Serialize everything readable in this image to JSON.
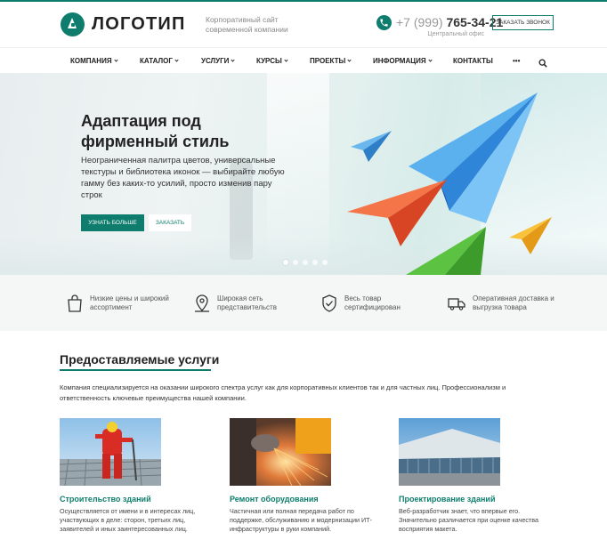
{
  "brand": {
    "logo_text": "ЛОГОТИП",
    "slogan": "Корпоративный сайт современной компании",
    "accent_color": "#0e7d6d"
  },
  "contact": {
    "phone_code": "+7 (999)",
    "phone_number": "765-34-21",
    "phone_caption": "Центральный офис",
    "order_call_label": "ЗАКАЗАТЬ ЗВОНОК"
  },
  "nav": {
    "items": [
      "КОМПАНИЯ",
      "КАТАЛОГ",
      "УСЛУГИ",
      "КУРСЫ",
      "ПРОЕКТЫ",
      "ИНФОРМАЦИЯ",
      "КОНТАКТЫ"
    ],
    "more": "•••",
    "search_icon": "search-icon"
  },
  "hero": {
    "title": "Адаптация под фирменный стиль",
    "text": "Неограниченная палитра цветов, универсальные текстуры и библиотека иконок — выбирайте любую гамму без каких-то усилий, просто изменив пару строк",
    "primary_button": "УЗНАТЬ БОЛЬШЕ",
    "secondary_button": "ЗАКАЗАТЬ",
    "slides_count": 5,
    "active_slide": 1
  },
  "features": [
    {
      "icon": "shopping-bag-icon",
      "text": "Низкие цены и широкий ассортимент"
    },
    {
      "icon": "map-pin-icon",
      "text": "Широкая сеть представительств"
    },
    {
      "icon": "shield-check-icon",
      "text": "Весь товар сертифицирован"
    },
    {
      "icon": "truck-icon",
      "text": "Оперативная доставка и выгрузка товара"
    }
  ],
  "services": {
    "title": "Предоставляемые услуги",
    "description": "Компания специализируется на оказании широкого спектра услуг как для корпоративных клиентов так и для частных лиц. Профессионализм и ответственность ключевые преимущества нашей компании.",
    "cards": [
      {
        "title": "Строительство зданий",
        "text": "Осуществляется от имени и в интересах лиц, участвующих в деле: сторон, третьих лиц, заявителей и иных заинтересованных лиц."
      },
      {
        "title": "Ремонт оборудования",
        "text": "Частичная или полная передача работ по поддержке, обслуживанию и модернизации ИТ-инфраструктуры в руки компаний."
      },
      {
        "title": "Проектирование зданий",
        "text": "Веб-разработчик знает, что впервые его. Значительно различается при оценке качества восприятия макета."
      }
    ]
  }
}
